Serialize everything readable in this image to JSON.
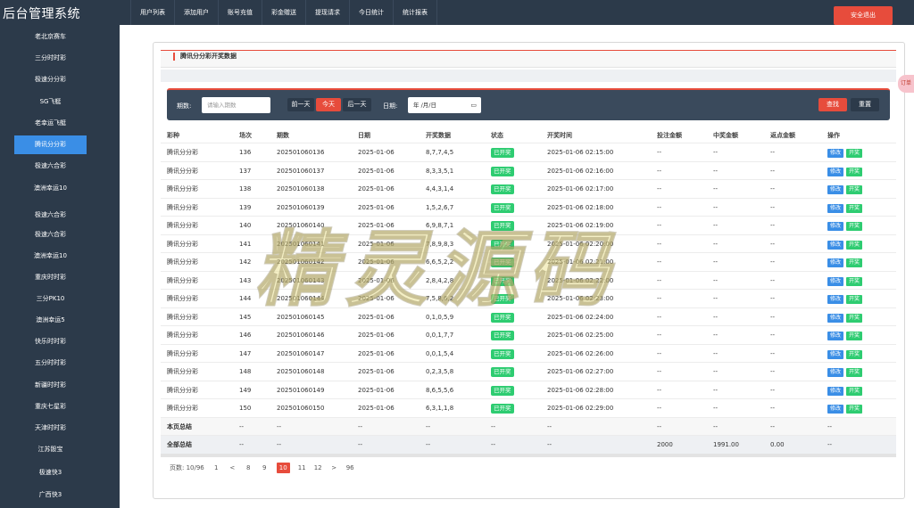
{
  "app_title": "后台管理系统",
  "nav": [
    "用户列表",
    "添加用户",
    "账号充值",
    "彩金赠送",
    "提现请求",
    "今日统计",
    "统计报表"
  ],
  "logout_label": "安全退出",
  "sidebar": [
    "老北京赛车",
    "三分时时彩",
    "极速分分彩",
    "SG飞艇",
    "老幸运飞艇",
    "腾讯分分彩",
    "极速六合彩",
    "澳洲幸运10",
    "极速六合彩",
    "极速六合彩",
    "澳洲幸运10",
    "重庆时时彩",
    "三分PK10",
    "澳洲幸运5",
    "快乐时时彩",
    "五分时时彩",
    "新疆时时彩",
    "重庆七星彩",
    "天津时时彩",
    "江苏骰宝",
    "极速快3",
    "广西快3"
  ],
  "sidebar_active": 5,
  "panel_title": "腾讯分分彩开奖数据",
  "filter": {
    "period_label": "期数:",
    "period_placeholder": "请输入期数",
    "prev_day": "前一天",
    "today": "今天",
    "next_day": "后一天",
    "date_label": "日期:",
    "date_value": "年 /月/日",
    "search": "查找",
    "reset": "重置"
  },
  "columns": [
    "彩种",
    "场次",
    "期数",
    "日期",
    "开奖数据",
    "状态",
    "开奖时间",
    "投注金额",
    "中奖金额",
    "返点金额",
    "操作"
  ],
  "rows": [
    {
      "game": "腾讯分分彩",
      "round": "136",
      "period": "202501060136",
      "date": "2025-01-06",
      "numbers": "8,7,7,4,5",
      "status": "已开奖",
      "time": "2025-01-06 02:15:00",
      "bet": "--",
      "win": "--",
      "rebate": "--"
    },
    {
      "game": "腾讯分分彩",
      "round": "137",
      "period": "202501060137",
      "date": "2025-01-06",
      "numbers": "8,3,3,5,1",
      "status": "已开奖",
      "time": "2025-01-06 02:16:00",
      "bet": "--",
      "win": "--",
      "rebate": "--"
    },
    {
      "game": "腾讯分分彩",
      "round": "138",
      "period": "202501060138",
      "date": "2025-01-06",
      "numbers": "4,4,3,1,4",
      "status": "已开奖",
      "time": "2025-01-06 02:17:00",
      "bet": "--",
      "win": "--",
      "rebate": "--"
    },
    {
      "game": "腾讯分分彩",
      "round": "139",
      "period": "202501060139",
      "date": "2025-01-06",
      "numbers": "1,5,2,6,7",
      "status": "已开奖",
      "time": "2025-01-06 02:18:00",
      "bet": "--",
      "win": "--",
      "rebate": "--"
    },
    {
      "game": "腾讯分分彩",
      "round": "140",
      "period": "202501060140",
      "date": "2025-01-06",
      "numbers": "6,9,8,7,1",
      "status": "已开奖",
      "time": "2025-01-06 02:19:00",
      "bet": "--",
      "win": "--",
      "rebate": "--"
    },
    {
      "game": "腾讯分分彩",
      "round": "141",
      "period": "202501060141",
      "date": "2025-01-06",
      "numbers": "7,8,9,8,3",
      "status": "已开奖",
      "time": "2025-01-06 02:20:00",
      "bet": "--",
      "win": "--",
      "rebate": "--"
    },
    {
      "game": "腾讯分分彩",
      "round": "142",
      "period": "202501060142",
      "date": "2025-01-06",
      "numbers": "6,6,5,2,2",
      "status": "已开奖",
      "time": "2025-01-06 02:21:00",
      "bet": "--",
      "win": "--",
      "rebate": "--"
    },
    {
      "game": "腾讯分分彩",
      "round": "143",
      "period": "202501060143",
      "date": "2025-01-06",
      "numbers": "2,8,4,2,8",
      "status": "已开奖",
      "time": "2025-01-06 02:22:00",
      "bet": "--",
      "win": "--",
      "rebate": "--"
    },
    {
      "game": "腾讯分分彩",
      "round": "144",
      "period": "202501060144",
      "date": "2025-01-06",
      "numbers": "7,5,8,6,2",
      "status": "已开奖",
      "time": "2025-01-06 02:23:00",
      "bet": "--",
      "win": "--",
      "rebate": "--"
    },
    {
      "game": "腾讯分分彩",
      "round": "145",
      "period": "202501060145",
      "date": "2025-01-06",
      "numbers": "0,1,0,5,9",
      "status": "已开奖",
      "time": "2025-01-06 02:24:00",
      "bet": "--",
      "win": "--",
      "rebate": "--"
    },
    {
      "game": "腾讯分分彩",
      "round": "146",
      "period": "202501060146",
      "date": "2025-01-06",
      "numbers": "0,0,1,7,7",
      "status": "已开奖",
      "time": "2025-01-06 02:25:00",
      "bet": "--",
      "win": "--",
      "rebate": "--"
    },
    {
      "game": "腾讯分分彩",
      "round": "147",
      "period": "202501060147",
      "date": "2025-01-06",
      "numbers": "0,0,1,5,4",
      "status": "已开奖",
      "time": "2025-01-06 02:26:00",
      "bet": "--",
      "win": "--",
      "rebate": "--"
    },
    {
      "game": "腾讯分分彩",
      "round": "148",
      "period": "202501060148",
      "date": "2025-01-06",
      "numbers": "0,2,3,5,8",
      "status": "已开奖",
      "time": "2025-01-06 02:27:00",
      "bet": "--",
      "win": "--",
      "rebate": "--"
    },
    {
      "game": "腾讯分分彩",
      "round": "149",
      "period": "202501060149",
      "date": "2025-01-06",
      "numbers": "8,6,5,5,6",
      "status": "已开奖",
      "time": "2025-01-06 02:28:00",
      "bet": "--",
      "win": "--",
      "rebate": "--"
    },
    {
      "game": "腾讯分分彩",
      "round": "150",
      "period": "202501060150",
      "date": "2025-01-06",
      "numbers": "6,3,1,1,8",
      "status": "已开奖",
      "time": "2025-01-06 02:29:00",
      "bet": "--",
      "win": "--",
      "rebate": "--"
    }
  ],
  "op_edit": "修改",
  "op_draw": "开奖",
  "page_total": {
    "label": "本页总结",
    "cells": [
      "--",
      "--",
      "--",
      "--",
      "--",
      "--",
      "--",
      "--",
      "--",
      "--"
    ]
  },
  "all_total": {
    "label": "全部总结",
    "cells": [
      "--",
      "--",
      "--",
      "--",
      "--",
      "--",
      "2000",
      "1991.00",
      "0.00",
      "--"
    ]
  },
  "pager": {
    "info": "页数: 10/96",
    "pages": [
      "1",
      "<",
      "8",
      "9",
      "10",
      "11",
      "12",
      ">",
      "96"
    ],
    "current": "10"
  },
  "watermark": "精灵源码",
  "float_tab": "订单",
  "colors": {
    "accent": "#e74c3c",
    "nav_bg": "#2c3a4a",
    "active_blue": "#3a8ee6",
    "status_green": "#2ecc71"
  }
}
